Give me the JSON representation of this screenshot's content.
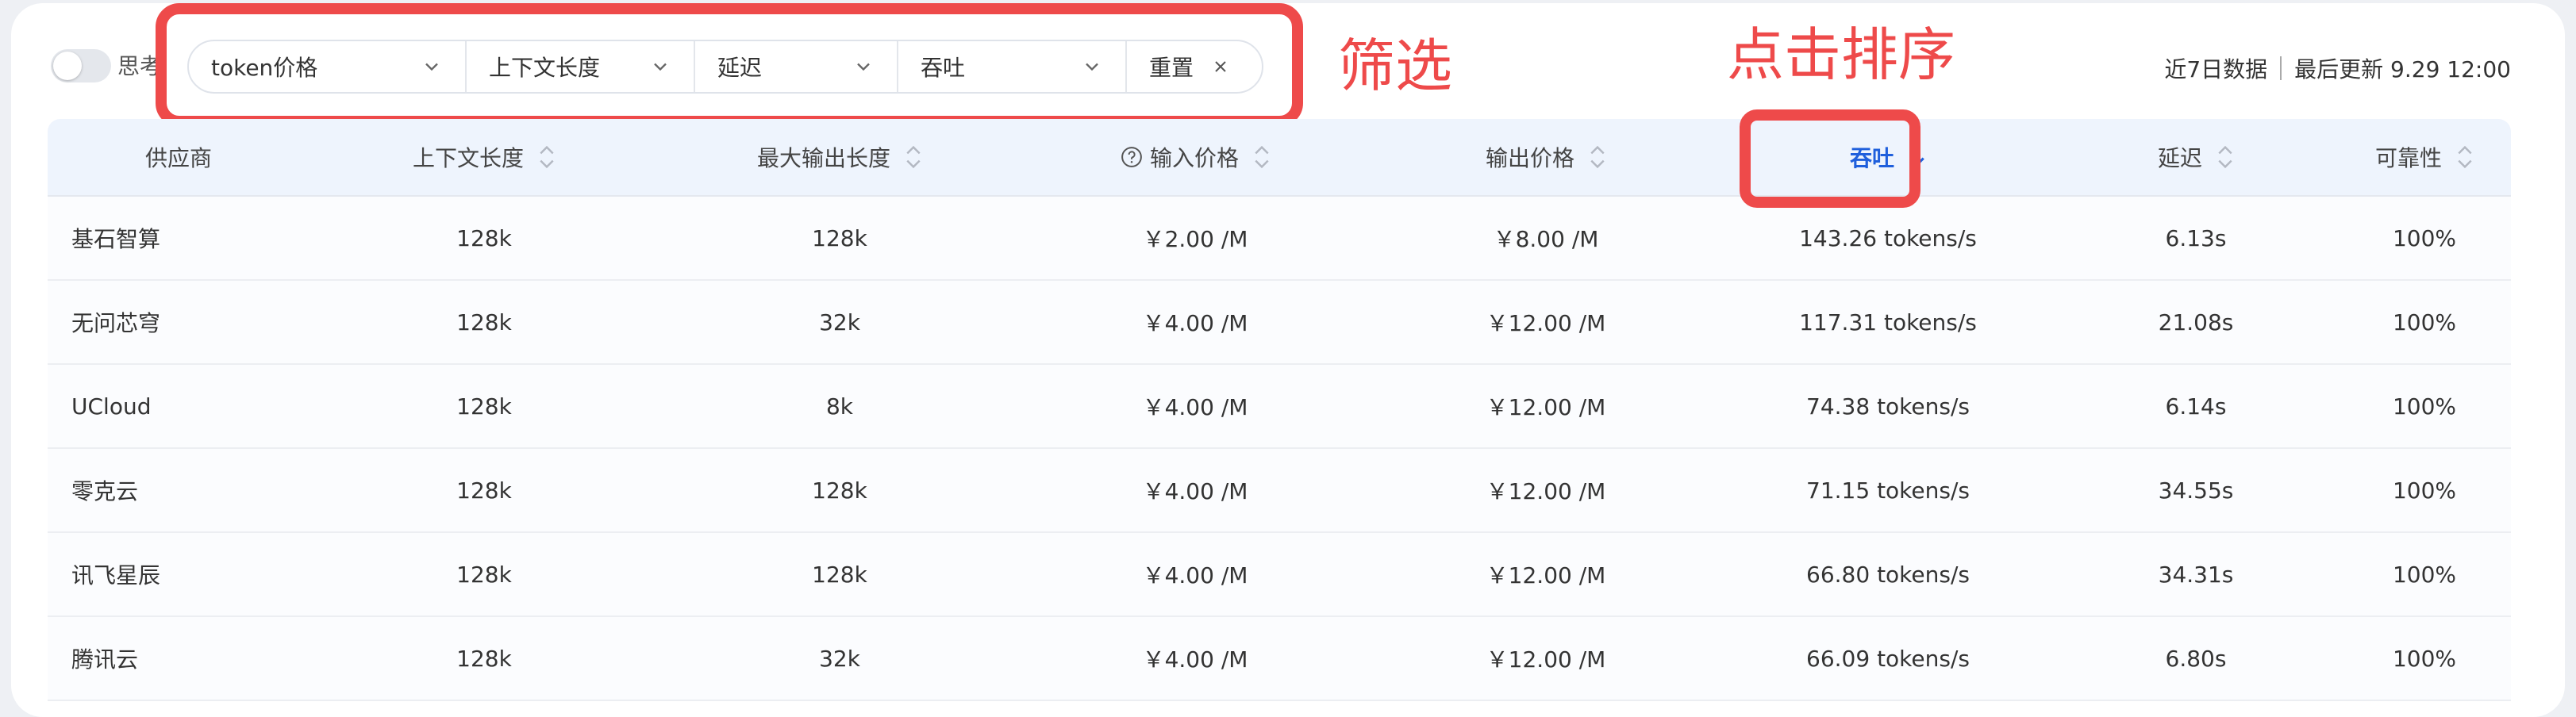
{
  "toolbar": {
    "think_label": "思考",
    "filters": [
      {
        "label": "token价格"
      },
      {
        "label": "上下文长度"
      },
      {
        "label": "延迟"
      },
      {
        "label": "吞吐"
      }
    ],
    "reset_label": "重置",
    "meta_range": "近7日数据",
    "meta_updated": "最后更新 9.29 12:00"
  },
  "annotations": {
    "filter": "筛选",
    "sort": "点击排序"
  },
  "colors": {
    "annotation": "#ee4a4a",
    "active_sort": "#1f5fdc",
    "header_bg": "#eef4fd"
  },
  "table": {
    "columns": [
      "供应商",
      "上下文长度",
      "最大输出长度",
      "输入价格",
      "输出价格",
      "吞吐",
      "延迟",
      "可靠性"
    ],
    "active_sort_column": "吞吐",
    "active_sort_direction": "descending",
    "rows": [
      [
        "基石智算",
        "128k",
        "128k",
        "￥2.00 /M",
        "￥8.00 /M",
        "143.26 tokens/s",
        "6.13s",
        "100%"
      ],
      [
        "无问芯穹",
        "128k",
        "32k",
        "￥4.00 /M",
        "￥12.00 /M",
        "117.31 tokens/s",
        "21.08s",
        "100%"
      ],
      [
        "UCloud",
        "128k",
        "8k",
        "￥4.00 /M",
        "￥12.00 /M",
        "74.38 tokens/s",
        "6.14s",
        "100%"
      ],
      [
        "零克云",
        "128k",
        "128k",
        "￥4.00 /M",
        "￥12.00 /M",
        "71.15 tokens/s",
        "34.55s",
        "100%"
      ],
      [
        "讯飞星辰",
        "128k",
        "128k",
        "￥4.00 /M",
        "￥12.00 /M",
        "66.80 tokens/s",
        "34.31s",
        "100%"
      ],
      [
        "腾讯云",
        "128k",
        "32k",
        "￥4.00 /M",
        "￥12.00 /M",
        "66.09 tokens/s",
        "6.80s",
        "100%"
      ]
    ]
  }
}
